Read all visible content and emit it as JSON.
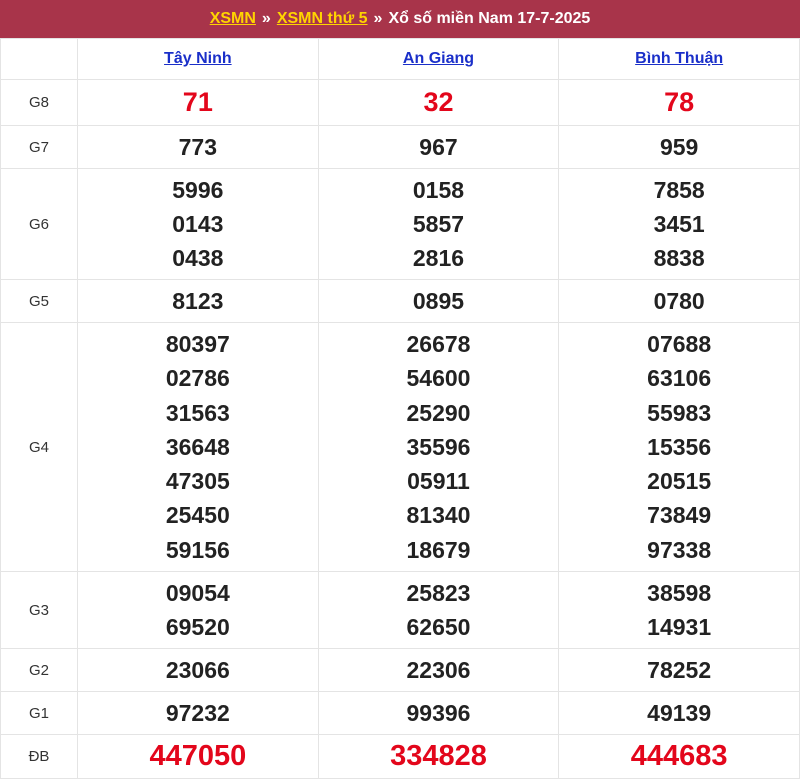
{
  "header": {
    "link1": "XSMN",
    "sep1": "»",
    "link2": "XSMN thứ 5",
    "sep2": "»",
    "title": "Xổ số miền Nam 17-7-2025"
  },
  "provinces": [
    "Tây Ninh",
    "An Giang",
    "Bình Thuận"
  ],
  "prizes": [
    {
      "label": "G8",
      "cls": "g8",
      "values": [
        [
          "71"
        ],
        [
          "32"
        ],
        [
          "78"
        ]
      ]
    },
    {
      "label": "G7",
      "cls": "g7",
      "values": [
        [
          "773"
        ],
        [
          "967"
        ],
        [
          "959"
        ]
      ]
    },
    {
      "label": "G6",
      "cls": "g6",
      "values": [
        [
          "5996",
          "0143",
          "0438"
        ],
        [
          "0158",
          "5857",
          "2816"
        ],
        [
          "7858",
          "3451",
          "8838"
        ]
      ]
    },
    {
      "label": "G5",
      "cls": "g5",
      "values": [
        [
          "8123"
        ],
        [
          "0895"
        ],
        [
          "0780"
        ]
      ]
    },
    {
      "label": "G4",
      "cls": "g4",
      "values": [
        [
          "80397",
          "02786",
          "31563",
          "36648",
          "47305",
          "25450",
          "59156"
        ],
        [
          "26678",
          "54600",
          "25290",
          "35596",
          "05911",
          "81340",
          "18679"
        ],
        [
          "07688",
          "63106",
          "55983",
          "15356",
          "20515",
          "73849",
          "97338"
        ]
      ]
    },
    {
      "label": "G3",
      "cls": "g3",
      "values": [
        [
          "09054",
          "69520"
        ],
        [
          "25823",
          "62650"
        ],
        [
          "38598",
          "14931"
        ]
      ]
    },
    {
      "label": "G2",
      "cls": "g2",
      "values": [
        [
          "23066"
        ],
        [
          "22306"
        ],
        [
          "78252"
        ]
      ]
    },
    {
      "label": "G1",
      "cls": "g1",
      "values": [
        [
          "97232"
        ],
        [
          "99396"
        ],
        [
          "49139"
        ]
      ]
    },
    {
      "label": "ĐB",
      "cls": "db",
      "values": [
        [
          "447050"
        ],
        [
          "334828"
        ],
        [
          "444683"
        ]
      ]
    }
  ]
}
